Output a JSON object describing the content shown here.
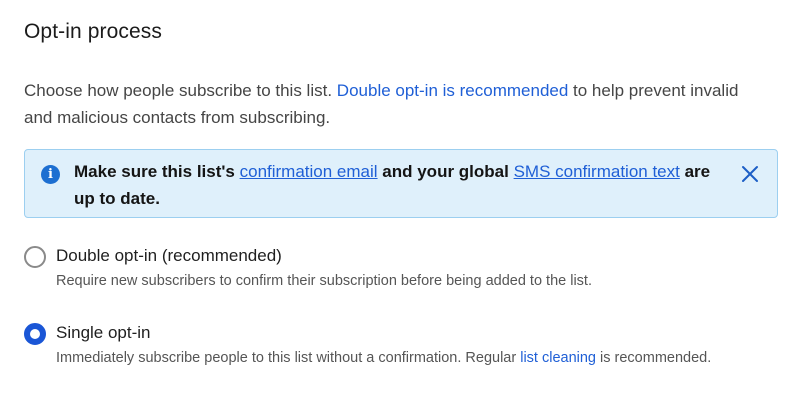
{
  "section": {
    "title": "Opt-in process"
  },
  "intro": {
    "text_before": "Choose how people subscribe to this list. ",
    "link": "Double opt-in is recommended",
    "text_after": " to help prevent invalid and malicious contacts from subscribing."
  },
  "banner": {
    "icon": "info-icon",
    "part1": "Make sure this list's ",
    "link1": "confirmation email",
    "part2": " and your global ",
    "link2": "SMS confirmation text",
    "part3": " are up to date.",
    "close_icon": "close-icon",
    "colors": {
      "background": "#dff0fb",
      "border": "#9ccff0",
      "icon": "#1d6fd1"
    }
  },
  "options": [
    {
      "label": "Double opt-in (recommended)",
      "description": "Require new subscribers to confirm their subscription before being added to the list.",
      "selected": false
    },
    {
      "label": "Single opt-in",
      "description_before": "Immediately subscribe people to this list without a confirmation. Regular ",
      "description_link": "list cleaning",
      "description_after": " is recommended.",
      "selected": true
    }
  ],
  "colors": {
    "accent": "#1a56d6",
    "link": "#1f5fd6"
  }
}
